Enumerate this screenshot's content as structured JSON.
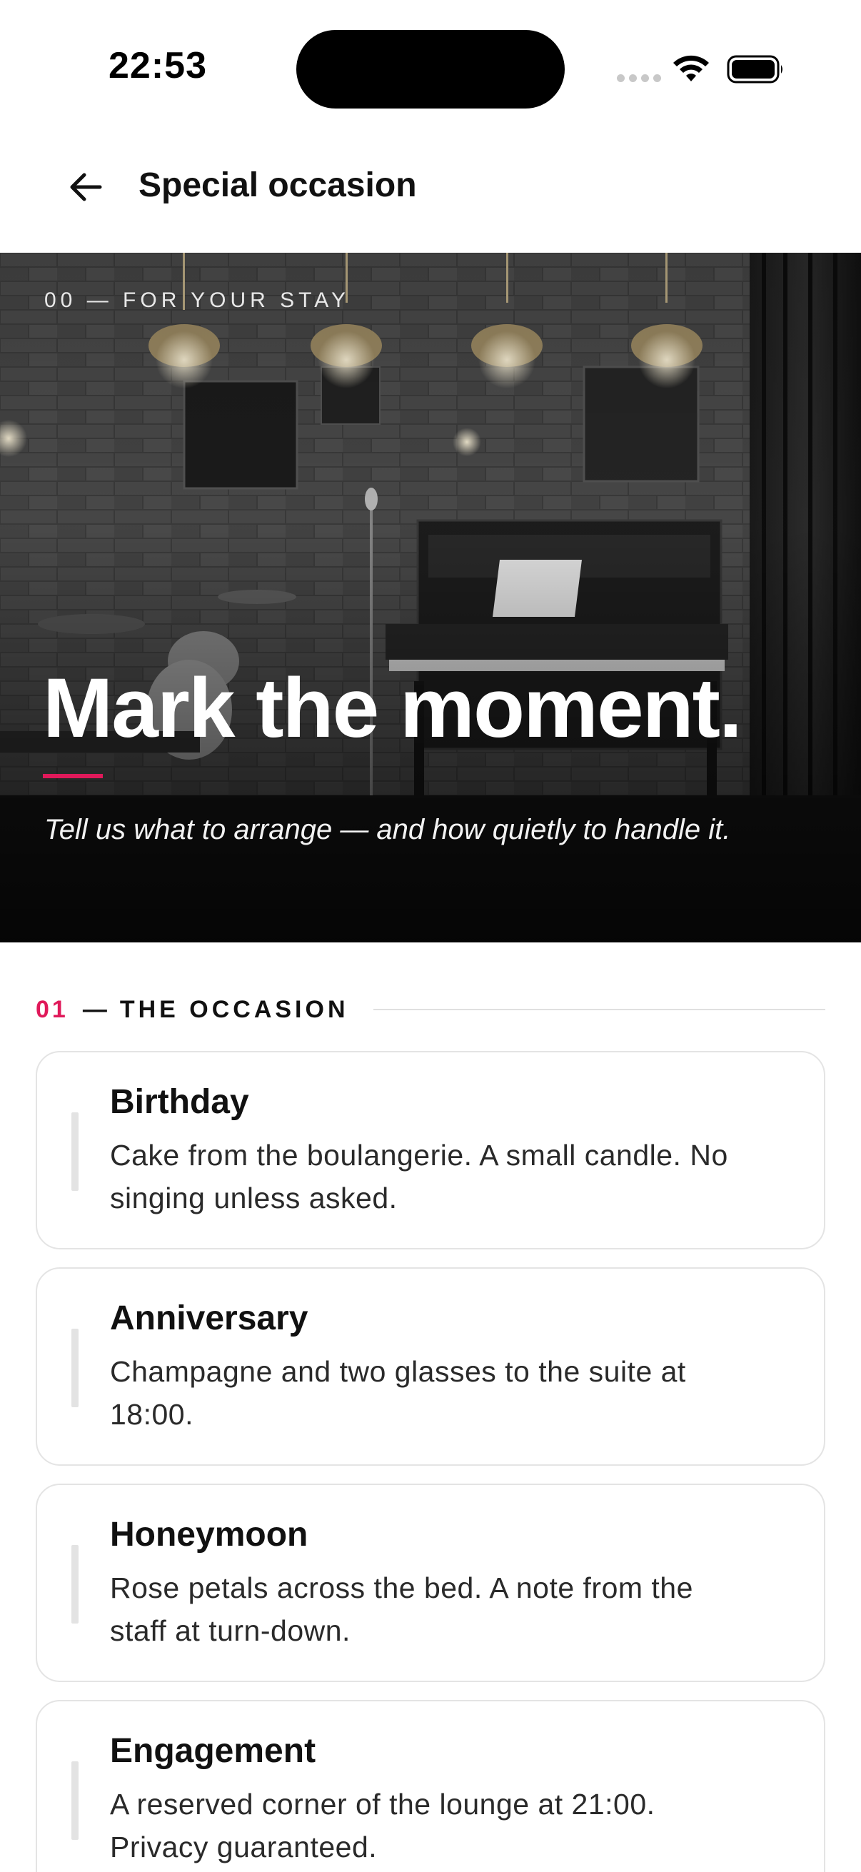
{
  "status_bar": {
    "time": "22:53"
  },
  "header": {
    "title": "Special occasion",
    "back_icon": "arrow-left-icon"
  },
  "hero": {
    "eyebrow": "00 — FOR YOUR STAY",
    "headline": "Mark the moment.",
    "subtitle": "Tell us what to arrange — and how quietly to handle it.",
    "accent_color": "#e0195a"
  },
  "section": {
    "number": "01",
    "dash": "—",
    "label": "THE OCCASION"
  },
  "occasions": [
    {
      "title": "Birthday",
      "description": "Cake from the boulangerie. A small candle. No singing unless asked."
    },
    {
      "title": "Anniversary",
      "description": "Champagne and two glasses to the suite at 18:00."
    },
    {
      "title": "Honeymoon",
      "description": "Rose petals across the bed. A note from the staff at turn-down."
    },
    {
      "title": "Engagement",
      "description": "A reserved corner of the lounge at 21:00. Privacy guaranteed."
    }
  ]
}
